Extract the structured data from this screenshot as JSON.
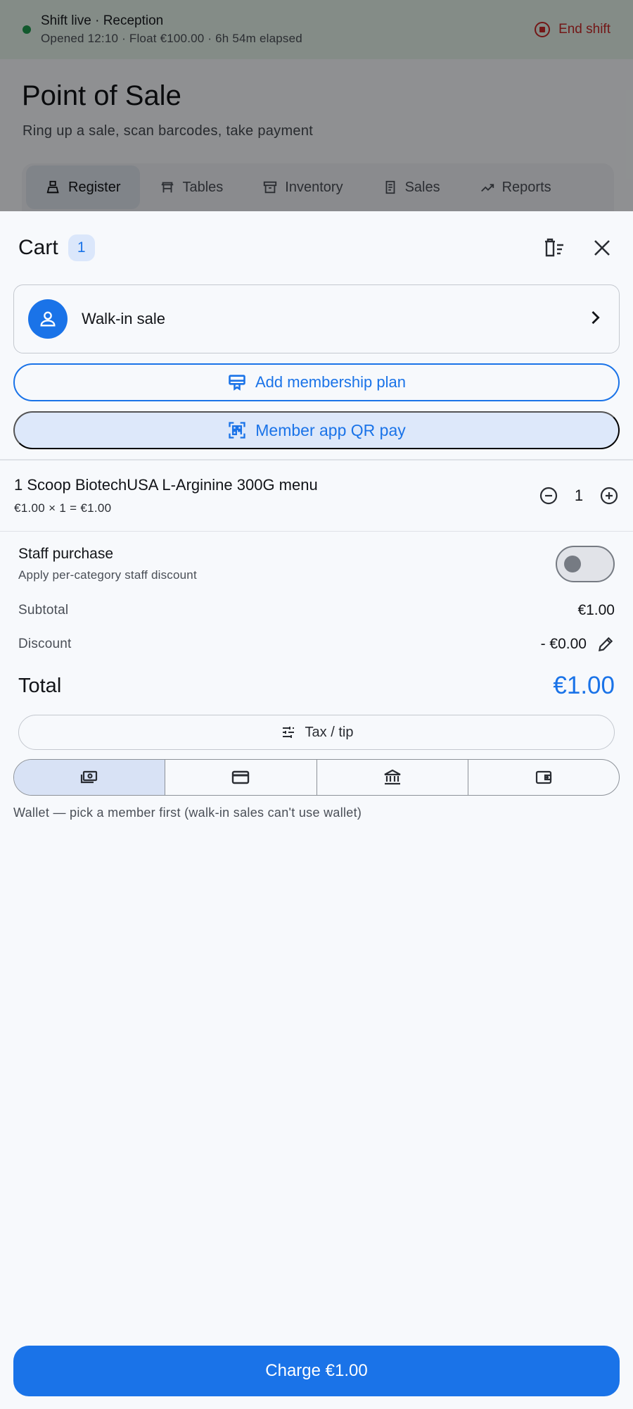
{
  "shift": {
    "title": "Shift live · Reception",
    "details": "Opened 12:10 · Float €100.00 · 6h 54m elapsed",
    "end_label": "End shift"
  },
  "page": {
    "title": "Point of Sale",
    "subtitle": "Ring up a sale, scan barcodes, take payment"
  },
  "tabs": [
    {
      "label": "Register",
      "icon": "register-icon",
      "active": true
    },
    {
      "label": "Tables",
      "icon": "table-icon"
    },
    {
      "label": "Inventory",
      "icon": "inventory-icon"
    },
    {
      "label": "Sales",
      "icon": "receipt-icon"
    },
    {
      "label": "Reports",
      "icon": "trend-icon"
    }
  ],
  "cart": {
    "title": "Cart",
    "count": "1",
    "customer": "Walk-in sale",
    "add_membership_label": "Add membership plan",
    "qr_pay_label": "Member app QR pay",
    "items": [
      {
        "name": "1 Scoop BiotechUSA L-Arginine 300G menu",
        "detail": "€1.00 × 1 = €1.00",
        "qty": "1"
      }
    ],
    "staff": {
      "title": "Staff purchase",
      "subtitle": "Apply per-category staff discount",
      "enabled": false
    },
    "subtotal_label": "Subtotal",
    "subtotal": "€1.00",
    "discount_label": "Discount",
    "discount": "- €0.00",
    "total_label": "Total",
    "total": "€1.00",
    "tax_tip_label": "Tax / tip",
    "payment_methods": [
      {
        "icon": "cash-icon",
        "selected": true
      },
      {
        "icon": "card-icon",
        "selected": false
      },
      {
        "icon": "bank-icon",
        "selected": false
      },
      {
        "icon": "wallet-icon",
        "selected": false
      }
    ],
    "wallet_note": "Wallet — pick a member first (walk-in sales can't use wallet)",
    "charge_label": "Charge €1.00"
  },
  "colors": {
    "primary": "#1a73e8",
    "danger": "#c62828",
    "live": "#1f9a4f"
  }
}
